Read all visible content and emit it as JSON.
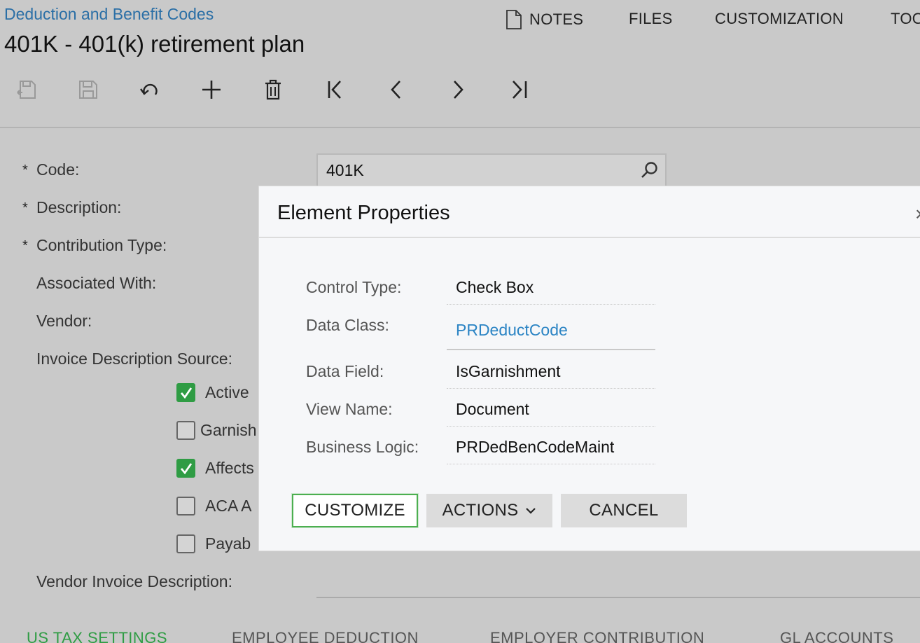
{
  "header": {
    "breadcrumb": "Deduction and Benefit Codes",
    "title": "401K - 401(k) retirement plan",
    "menu": {
      "notes": "NOTES",
      "files": "FILES",
      "customization": "CUSTOMIZATION",
      "tools": "TOO"
    }
  },
  "toolbar": {
    "icons": [
      "save-close-icon",
      "save-icon",
      "undo-icon",
      "add-icon",
      "delete-icon",
      "first-icon",
      "previous-icon",
      "next-icon",
      "last-icon"
    ]
  },
  "form": {
    "required_mark": "*",
    "code_label": "Code:",
    "code_value": "401K",
    "description_label": "Description:",
    "contribution_label": "Contribution Type:",
    "associated_label": "Associated With:",
    "vendor_label": "Vendor:",
    "invoice_source_label": "Invoice Description Source:",
    "checkboxes": [
      {
        "label": "Active",
        "checked": true
      },
      {
        "label": "Garnish",
        "checked": false
      },
      {
        "label": "Affects",
        "checked": true
      },
      {
        "label": "ACA A",
        "checked": false
      },
      {
        "label": "Payab",
        "checked": false
      }
    ],
    "vendor_invoice_label": "Vendor Invoice Description:"
  },
  "tabs": [
    "US TAX SETTINGS",
    "EMPLOYEE DEDUCTION",
    "EMPLOYER CONTRIBUTION",
    "GL ACCOUNTS"
  ],
  "dialog": {
    "title": "Element Properties",
    "close": "×",
    "props": {
      "control_type_label": "Control Type:",
      "control_type_value": "Check Box",
      "data_class_label": "Data Class:",
      "data_class_value": "PRDeductCode",
      "data_field_label": "Data Field:",
      "data_field_value": "IsGarnishment",
      "view_name_label": "View Name:",
      "view_name_value": "Document",
      "business_logic_label": "Business Logic:",
      "business_logic_value": "PRDedBenCodeMaint"
    },
    "buttons": {
      "customize": "CUSTOMIZE",
      "actions": "ACTIONS",
      "cancel": "CANCEL"
    }
  },
  "colors": {
    "accent_green": "#2f9c44",
    "link_blue": "#2b84c4",
    "breadcrumb_blue": "#2b6fa6"
  }
}
